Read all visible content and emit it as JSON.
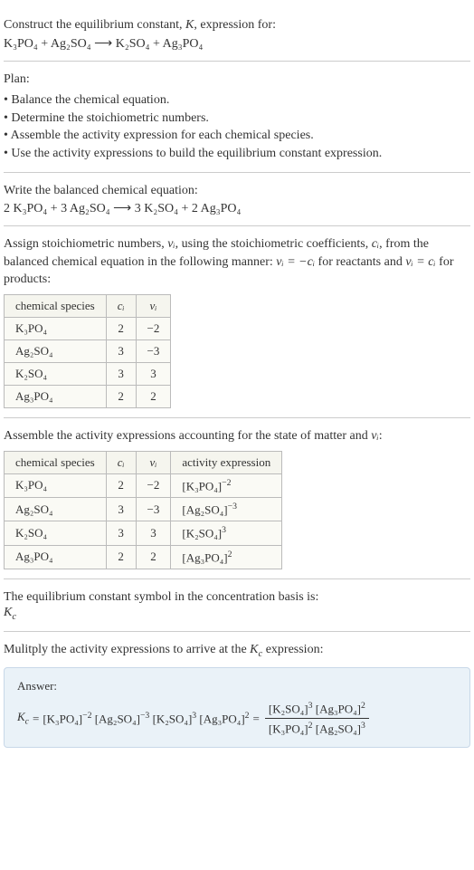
{
  "header": {
    "title_prefix": "Construct the equilibrium constant, ",
    "title_k": "K",
    "title_suffix": ", expression for:",
    "equation": "K₃PO₄ + Ag₂SO₄ ⟶ K₂SO₄ + Ag₃PO₄"
  },
  "plan": {
    "title": "Plan:",
    "items": [
      "Balance the chemical equation.",
      "Determine the stoichiometric numbers.",
      "Assemble the activity expression for each chemical species.",
      "Use the activity expressions to build the equilibrium constant expression."
    ]
  },
  "balanced": {
    "title": "Write the balanced chemical equation:",
    "equation": "2 K₃PO₄ + 3 Ag₂SO₄ ⟶ 3 K₂SO₄ + 2 Ag₃PO₄"
  },
  "stoich": {
    "text_prefix": "Assign stoichiometric numbers, ",
    "nu_i": "νᵢ",
    "text_mid1": ", using the stoichiometric coefficients, ",
    "c_i": "cᵢ",
    "text_mid2": ", from the balanced chemical equation in the following manner: ",
    "eq1": "νᵢ = −cᵢ",
    "text_mid3": " for reactants and ",
    "eq2": "νᵢ = cᵢ",
    "text_suffix": " for products:",
    "table": {
      "headers": [
        "chemical species",
        "cᵢ",
        "νᵢ"
      ],
      "rows": [
        {
          "species": "K₃PO₄",
          "c": "2",
          "nu": "−2"
        },
        {
          "species": "Ag₂SO₄",
          "c": "3",
          "nu": "−3"
        },
        {
          "species": "K₂SO₄",
          "c": "3",
          "nu": "3"
        },
        {
          "species": "Ag₃PO₄",
          "c": "2",
          "nu": "2"
        }
      ]
    }
  },
  "activity": {
    "title_prefix": "Assemble the activity expressions accounting for the state of matter and ",
    "nu_i": "νᵢ",
    "title_suffix": ":",
    "table": {
      "headers": [
        "chemical species",
        "cᵢ",
        "νᵢ",
        "activity expression"
      ],
      "rows": [
        {
          "species": "K₃PO₄",
          "c": "2",
          "nu": "−2",
          "expr_base": "[K₃PO₄]",
          "expr_exp": "−2"
        },
        {
          "species": "Ag₂SO₄",
          "c": "3",
          "nu": "−3",
          "expr_base": "[Ag₂SO₄]",
          "expr_exp": "−3"
        },
        {
          "species": "K₂SO₄",
          "c": "3",
          "nu": "3",
          "expr_base": "[K₂SO₄]",
          "expr_exp": "3"
        },
        {
          "species": "Ag₃PO₄",
          "c": "2",
          "nu": "2",
          "expr_base": "[Ag₃PO₄]",
          "expr_exp": "2"
        }
      ]
    }
  },
  "symbol": {
    "title": "The equilibrium constant symbol in the concentration basis is:",
    "kc_k": "K",
    "kc_c": "c"
  },
  "multiply": {
    "title_prefix": "Mulitply the activity expressions to arrive at the ",
    "kc_k": "K",
    "kc_c": "c",
    "title_suffix": " expression:"
  },
  "answer": {
    "label": "Answer:",
    "kc_k": "K",
    "kc_c": "c",
    "eq": " = ",
    "lhs": [
      {
        "base": "[K₃PO₄]",
        "exp": "−2"
      },
      {
        "base": "[Ag₂SO₄]",
        "exp": "−3"
      },
      {
        "base": "[K₂SO₄]",
        "exp": "3"
      },
      {
        "base": "[Ag₃PO₄]",
        "exp": "2"
      }
    ],
    "eq2": " = ",
    "frac": {
      "num": [
        {
          "base": "[K₂SO₄]",
          "exp": "3"
        },
        {
          "base": "[Ag₃PO₄]",
          "exp": "2"
        }
      ],
      "den": [
        {
          "base": "[K₃PO₄]",
          "exp": "2"
        },
        {
          "base": "[Ag₂SO₄]",
          "exp": "3"
        }
      ]
    }
  },
  "chart_data": {
    "type": "table",
    "tables": [
      {
        "title": "Stoichiometric numbers",
        "headers": [
          "chemical species",
          "c_i",
          "nu_i"
        ],
        "rows": [
          [
            "K3PO4",
            2,
            -2
          ],
          [
            "Ag2SO4",
            3,
            -3
          ],
          [
            "K2SO4",
            3,
            3
          ],
          [
            "Ag3PO4",
            2,
            2
          ]
        ]
      },
      {
        "title": "Activity expressions",
        "headers": [
          "chemical species",
          "c_i",
          "nu_i",
          "activity expression"
        ],
        "rows": [
          [
            "K3PO4",
            2,
            -2,
            "[K3PO4]^-2"
          ],
          [
            "Ag2SO4",
            3,
            -3,
            "[Ag2SO4]^-3"
          ],
          [
            "K2SO4",
            3,
            3,
            "[K2SO4]^3"
          ],
          [
            "Ag3PO4",
            2,
            2,
            "[Ag3PO4]^2"
          ]
        ]
      }
    ]
  }
}
